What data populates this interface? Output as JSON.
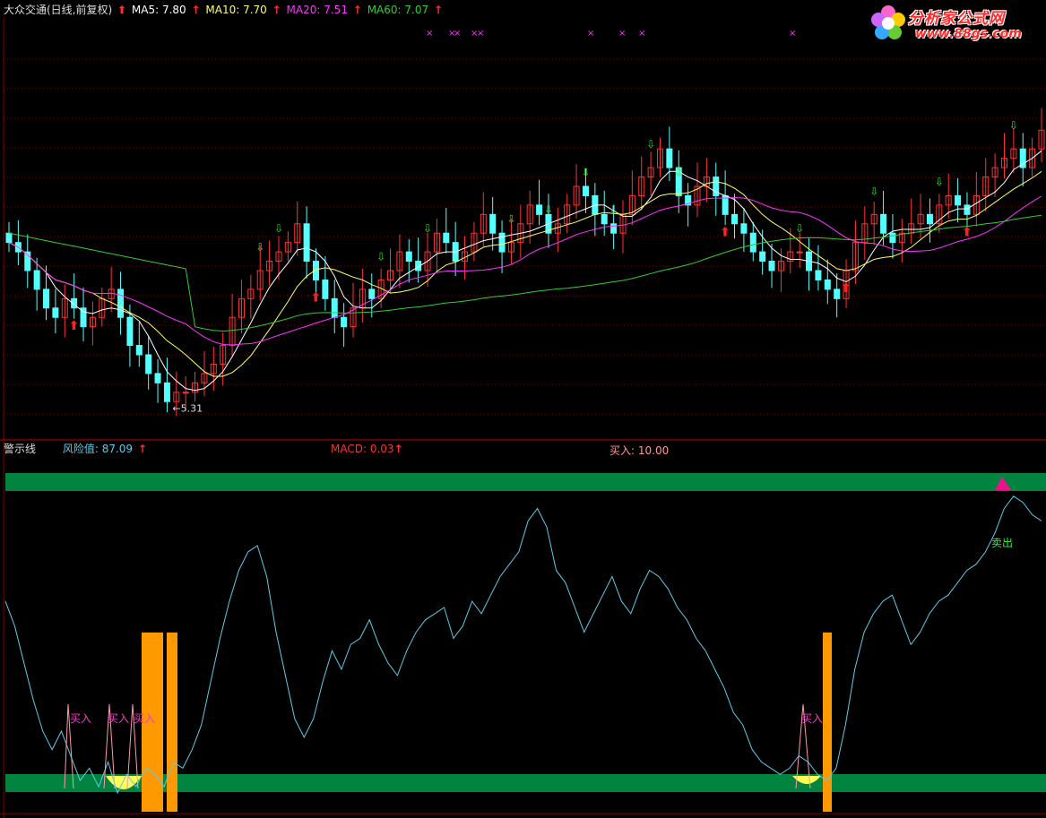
{
  "top_header": {
    "title": "大众交通(日线,前复权)",
    "ma5": "MA5: 7.80",
    "ma10": "MA10: 7.70",
    "ma20": "MA20: 7.51",
    "ma60": "MA60: 7.07",
    "arrow": "↑"
  },
  "bottom_header": {
    "title": "警示线",
    "risk": "风险值: 87.09",
    "macd": "MACD: 0.03",
    "buy": "买入: 10.00",
    "arrow": "↑"
  },
  "logo": {
    "name": "分析家公式网",
    "url": "www.88gs.com"
  },
  "colors": {
    "ma5": "#ffffff",
    "ma10": "#ffff66",
    "ma20": "#ff33ff",
    "ma60": "#33cc33",
    "up_candle": "#ff3333",
    "down_candle": "#54ffff",
    "risk_line": "#5fc9e8",
    "band": "#00843f",
    "buy_bar": "#ff9900",
    "grid": "#800000"
  },
  "chart_data": [
    {
      "type": "candlestick",
      "title": "大众交通(日线,前复权)",
      "series": [
        {
          "name": "MA5",
          "last": 7.8
        },
        {
          "name": "MA10",
          "last": 7.7
        },
        {
          "name": "MA20",
          "last": 7.51
        },
        {
          "name": "MA60",
          "last": 7.07
        }
      ],
      "ylim": [
        5.0,
        9.5
      ],
      "low_annotation": "5.31",
      "close": [
        7.1,
        7.0,
        6.8,
        6.6,
        6.4,
        6.3,
        6.5,
        6.4,
        6.2,
        6.3,
        6.5,
        6.6,
        6.3,
        6.0,
        5.9,
        5.7,
        5.6,
        5.4,
        5.5,
        5.5,
        5.6,
        5.7,
        5.8,
        6.0,
        6.3,
        6.5,
        6.6,
        6.8,
        6.9,
        7.0,
        7.1,
        7.3,
        6.9,
        6.7,
        6.5,
        6.3,
        6.2,
        6.4,
        6.6,
        6.5,
        6.7,
        6.8,
        7.0,
        6.9,
        6.8,
        7.0,
        7.2,
        7.1,
        6.9,
        7.0,
        7.2,
        7.4,
        7.2,
        7.0,
        7.1,
        7.3,
        7.5,
        7.4,
        7.2,
        7.3,
        7.5,
        7.7,
        7.6,
        7.4,
        7.3,
        7.2,
        7.4,
        7.6,
        7.8,
        7.9,
        8.1,
        7.9,
        7.6,
        7.5,
        7.7,
        7.8,
        7.6,
        7.4,
        7.3,
        7.2,
        7.0,
        6.9,
        6.8,
        6.9,
        7.0,
        7.0,
        6.8,
        6.7,
        6.6,
        6.5,
        6.8,
        7.1,
        7.3,
        7.4,
        7.2,
        7.1,
        7.2,
        7.3,
        7.4,
        7.3,
        7.5,
        7.6,
        7.5,
        7.4,
        7.6,
        7.8,
        7.9,
        8.0,
        8.1,
        7.9,
        8.1,
        8.3
      ]
    },
    {
      "type": "line",
      "title": "警示线",
      "series": [
        {
          "name": "风险值",
          "last": 87.09
        }
      ],
      "ylim": [
        0,
        100
      ],
      "values": [
        62,
        54,
        42,
        30,
        20,
        14,
        20,
        12,
        4,
        8,
        2,
        10,
        0,
        6,
        2,
        8,
        6,
        2,
        10,
        8,
        14,
        22,
        36,
        50,
        62,
        72,
        78,
        80,
        70,
        52,
        38,
        24,
        18,
        24,
        36,
        46,
        40,
        48,
        50,
        56,
        48,
        42,
        38,
        46,
        52,
        56,
        58,
        60,
        50,
        54,
        62,
        58,
        64,
        70,
        74,
        78,
        88,
        92,
        86,
        72,
        68,
        60,
        52,
        58,
        64,
        70,
        62,
        58,
        66,
        72,
        70,
        66,
        60,
        56,
        50,
        46,
        40,
        34,
        26,
        22,
        14,
        10,
        8,
        6,
        8,
        12,
        10,
        6,
        4,
        8,
        22,
        40,
        52,
        58,
        62,
        64,
        56,
        48,
        52,
        58,
        62,
        64,
        68,
        72,
        74,
        78,
        84,
        92,
        96,
        94,
        90,
        88
      ],
      "buy_labels": [
        "买入",
        "买入",
        "买入",
        "买入"
      ],
      "sell_label": "卖出"
    }
  ]
}
